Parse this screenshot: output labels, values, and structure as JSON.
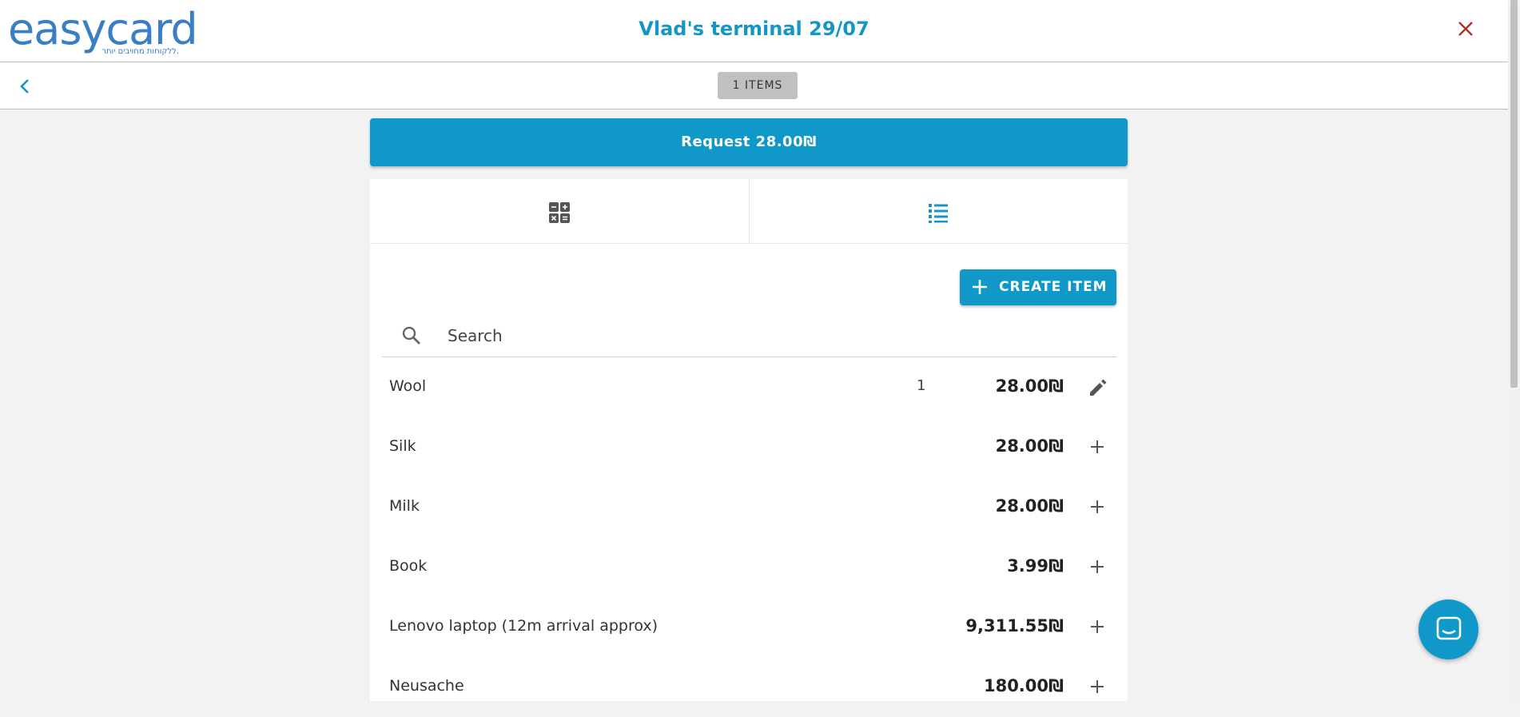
{
  "header": {
    "logo_text": "easycard",
    "logo_tagline": "ללקוחות מחויבים יותר.",
    "title": "Vlad's terminal 29/07"
  },
  "subbar": {
    "items_badge": "1 ITEMS"
  },
  "request_button": "Request 28.00₪",
  "tabs": [
    {
      "name": "calculator",
      "icon": "calculator-icon",
      "active": false
    },
    {
      "name": "items-list",
      "icon": "list-icon",
      "active": true
    }
  ],
  "create_button": "CREATE ITEM",
  "search": {
    "placeholder": "Search",
    "value": ""
  },
  "items": [
    {
      "name": "Wool",
      "qty": "1",
      "price": "28.00₪",
      "action_icon": "pencil-icon"
    },
    {
      "name": "Silk",
      "qty": "",
      "price": "28.00₪",
      "action_icon": "plus-icon"
    },
    {
      "name": "Milk",
      "qty": "",
      "price": "28.00₪",
      "action_icon": "plus-icon"
    },
    {
      "name": "Book",
      "qty": "",
      "price": "3.99₪",
      "action_icon": "plus-icon"
    },
    {
      "name": "Lenovo laptop (12m arrival approx)",
      "qty": "",
      "price": "9,311.55₪",
      "action_icon": "plus-icon"
    },
    {
      "name": "Neusache",
      "qty": "",
      "price": "180.00₪",
      "action_icon": "plus-icon"
    }
  ],
  "colors": {
    "accent": "#1098c8",
    "close": "#c0392b",
    "background": "#f2f2f2"
  }
}
